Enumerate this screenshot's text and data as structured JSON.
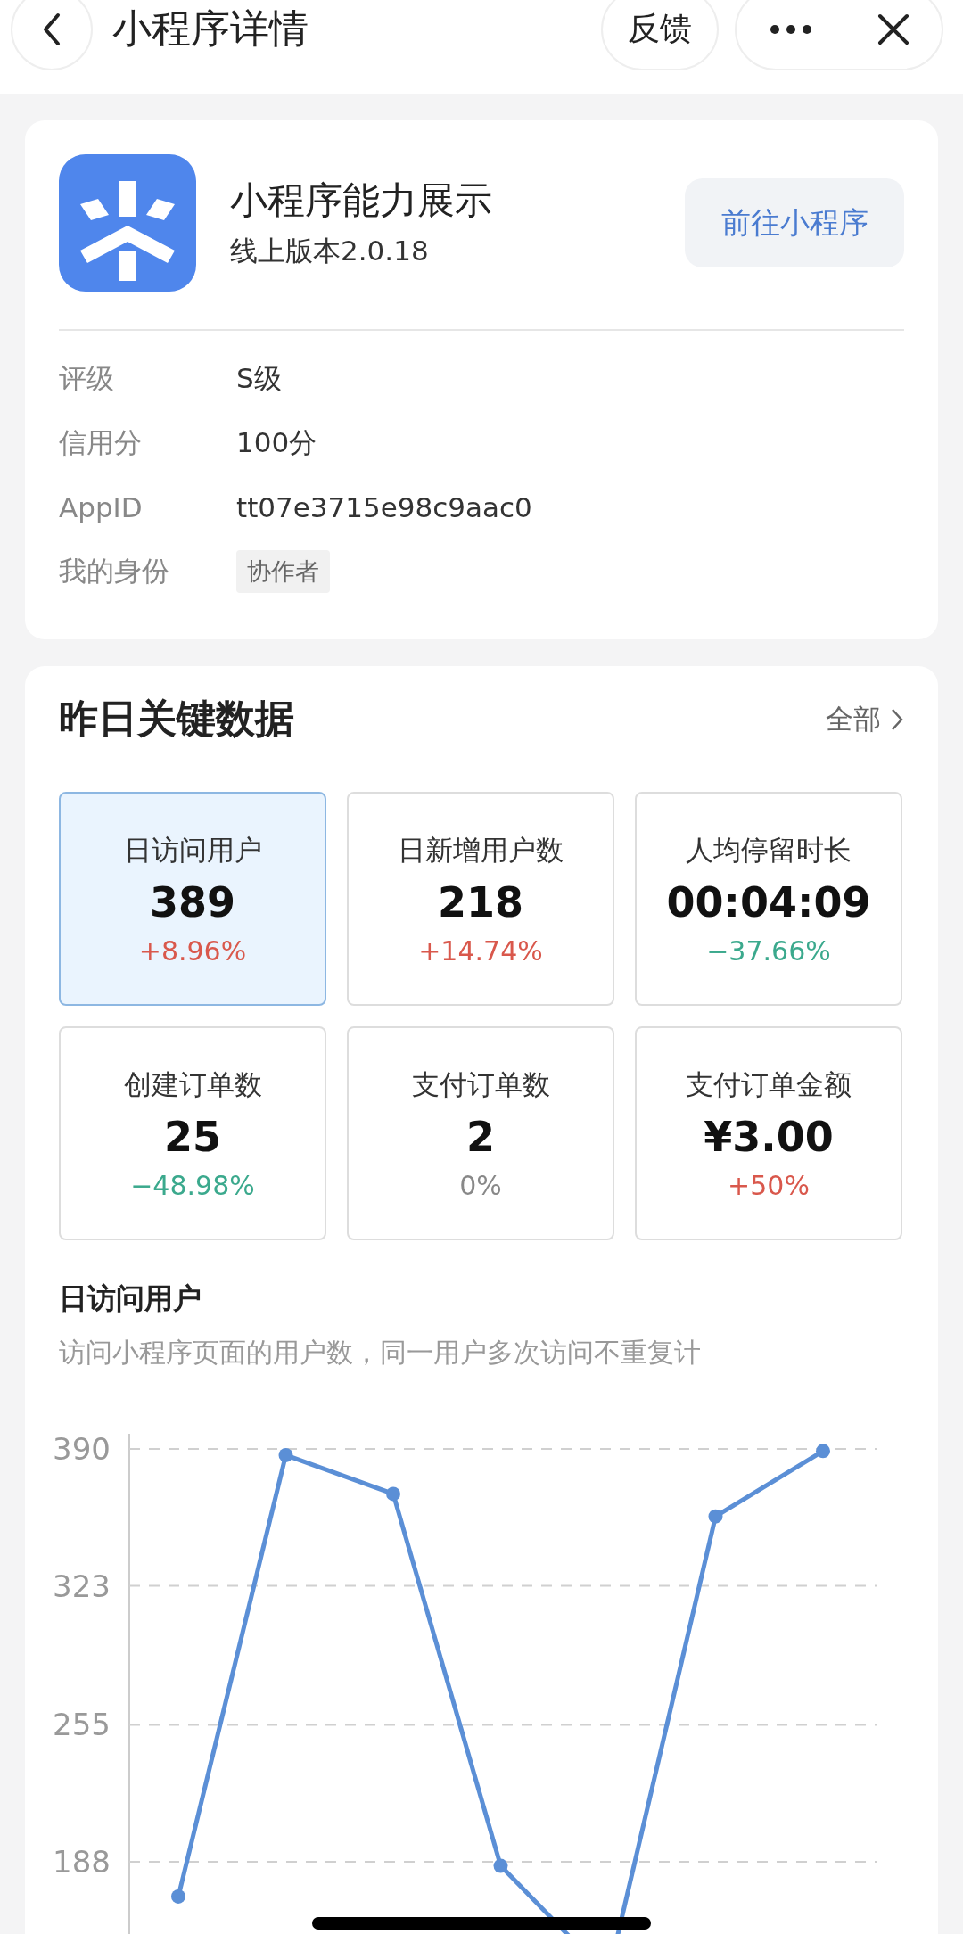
{
  "header": {
    "title": "小程序详情",
    "buttons": [
      {
        "kind": "text",
        "label": "反馈"
      }
    ]
  },
  "app": {
    "name": "小程序能力展示",
    "version": "线上版本2.0.18",
    "open_button": "前往小程序",
    "info": [
      {
        "label": "评级",
        "value": "S级",
        "kind": "text"
      },
      {
        "label": "信用分",
        "value": "100分",
        "kind": "text"
      },
      {
        "label": "AppID",
        "value": "tt07e3715e98c9aac0",
        "kind": "text"
      },
      {
        "label": "我的身份",
        "value": "协作者",
        "kind": "tag"
      }
    ]
  },
  "key_data": {
    "title": "昨日关键数据",
    "more": "全部",
    "metrics": [
      {
        "label": "日访问用户",
        "value": "389",
        "change": "+8.96%",
        "color": "#d9584c",
        "selected": true
      },
      {
        "label": "日新增用户数",
        "value": "218",
        "change": "+14.74%",
        "color": "#d9584c",
        "selected": false
      },
      {
        "label": "人均停留时长",
        "value": "00:04:09",
        "change": "−37.66%",
        "color": "#3ba98d",
        "selected": false
      },
      {
        "label": "创建订单数",
        "value": "25",
        "change": "−48.98%",
        "color": "#3ba98d",
        "selected": false
      },
      {
        "label": "支付订单数",
        "value": "2",
        "change": "0%",
        "color": "#888888",
        "selected": false
      },
      {
        "label": "支付订单金额",
        "value": "¥3.00",
        "change": "+50%",
        "color": "#d9584c",
        "selected": false
      }
    ],
    "chart_title": "日访问用户",
    "chart_note": "访问小程序页面的用户数，同一用户多次访问不重复计",
    "chart_data": {
      "type": "line",
      "series": [
        {
          "color": "#5b8fd6",
          "marker": "circle",
          "values": [
            171,
            387,
            368,
            186,
            132,
            357,
            389
          ]
        }
      ],
      "ylim": [
        110,
        390
      ],
      "yticks": [
        188,
        255,
        323,
        390
      ],
      "grid": true
    }
  }
}
